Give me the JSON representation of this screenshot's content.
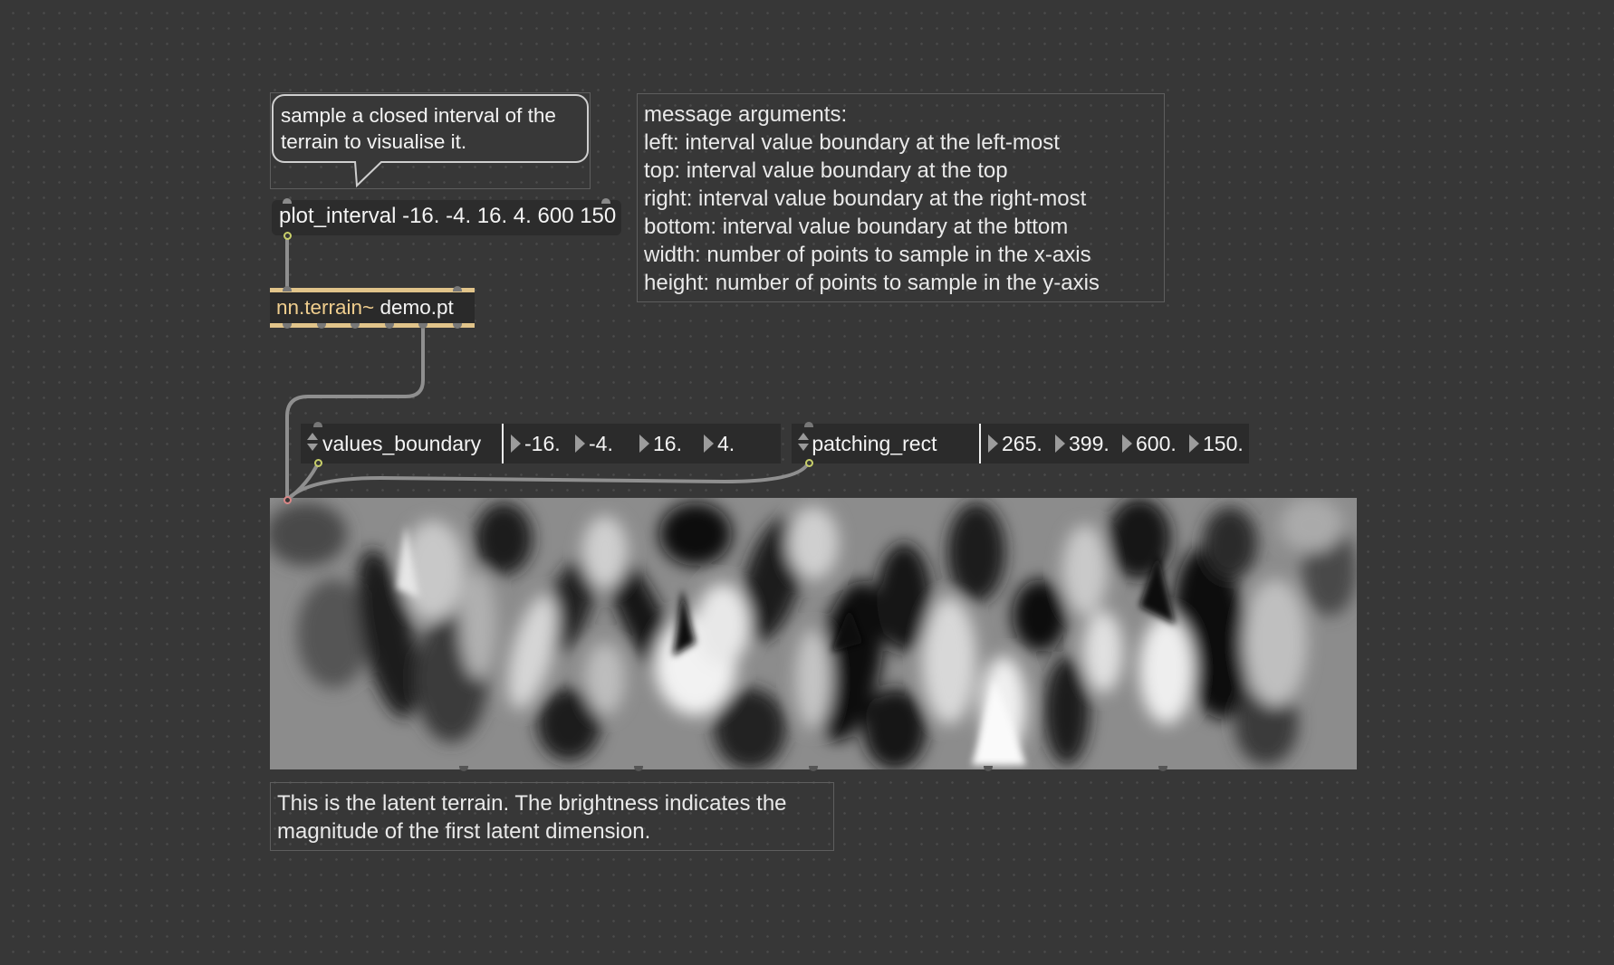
{
  "bubble_comment": {
    "lines": [
      "sample a closed interval of the",
      "terrain to visualise it."
    ]
  },
  "message_box": {
    "text": "plot_interval -16. -4. 16. 4. 600 150"
  },
  "object_box": {
    "class_name": "nn.terrain~",
    "argument": "demo.pt"
  },
  "arguments_comment": {
    "lines": [
      "message arguments:",
      "left: interval value boundary at the left-most",
      "top: interval value boundary at the top",
      "right: interval value boundary at the right-most",
      "bottom: interval value boundary at the bttom",
      "width: number of points to sample in the x-axis",
      "height: number of points to sample in the y-axis"
    ]
  },
  "attrui_values_boundary": {
    "name": "values_boundary",
    "values": [
      "-16.",
      "-4.",
      "16.",
      "4."
    ]
  },
  "attrui_patching_rect": {
    "name": "patching_rect",
    "values": [
      "265.",
      "399.",
      "600.",
      "150."
    ]
  },
  "terrain_display": {
    "icon": "latent-terrain-grayscale-image"
  },
  "terrain_comment": {
    "lines": [
      "This is the latent terrain. The brightness indicates the",
      "magnitude of the first latent dimension."
    ]
  },
  "colors": {
    "canvas_background": "#373737",
    "object_accent": "#e1c48a",
    "object_class_text": "#f0ce8e",
    "box_background": "#2b2b2b",
    "patch_cord": "#8f8f8f",
    "inlet_outlet_highlight": "#c8cf6a"
  }
}
